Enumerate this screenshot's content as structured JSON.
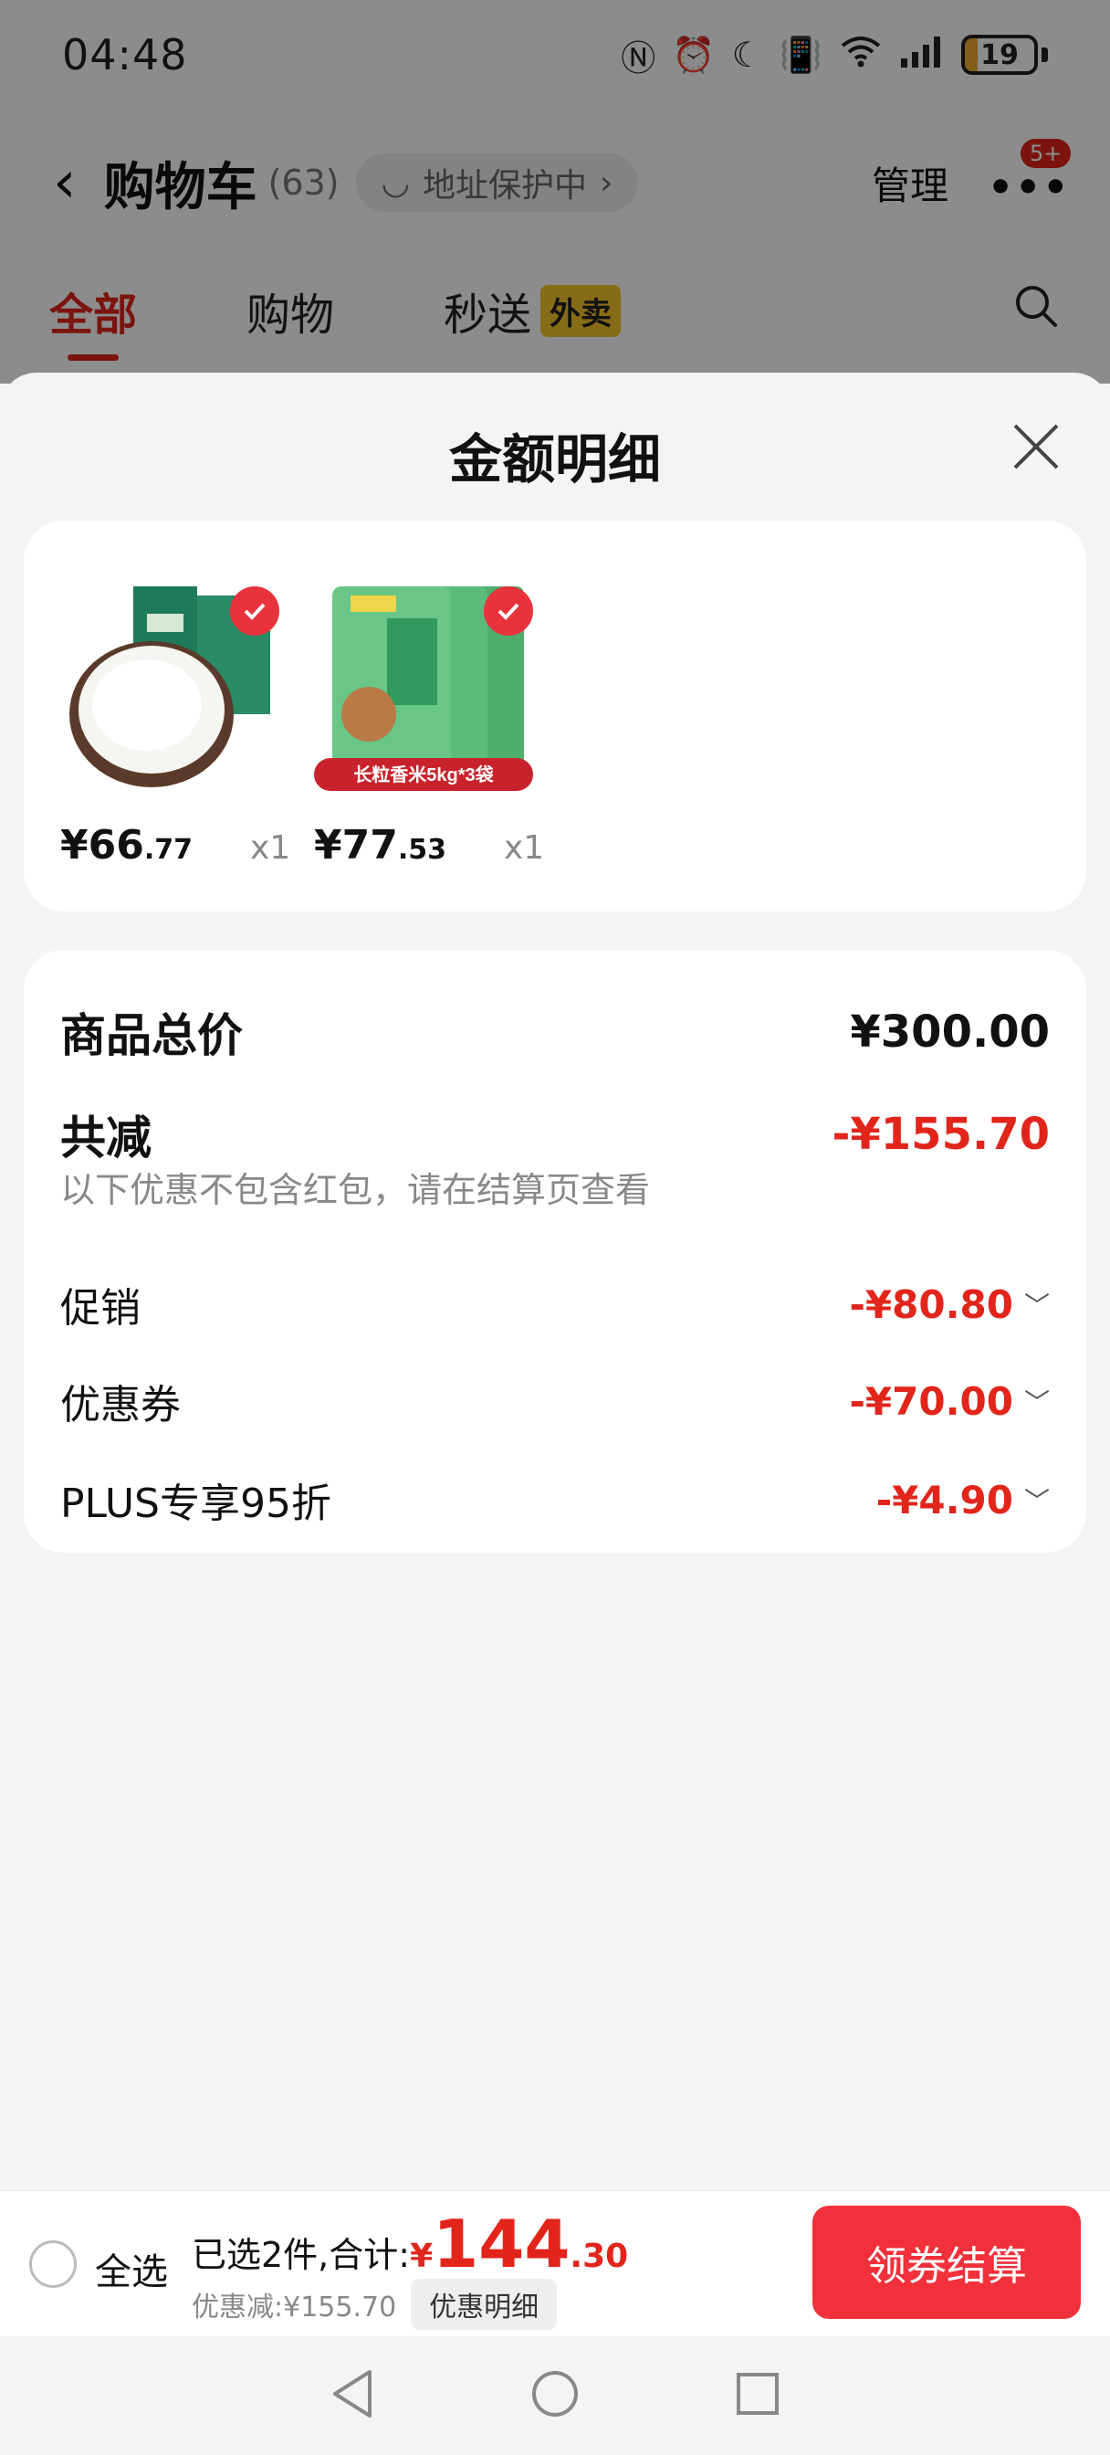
{
  "status_bar": {
    "time": "04:48",
    "battery": "19"
  },
  "header": {
    "title": "购物车",
    "count": "(63)",
    "address_label": "地址保护中",
    "manage_label": "管理",
    "more_badge": "5+"
  },
  "tabs": [
    {
      "label": "全部"
    },
    {
      "label": "购物"
    },
    {
      "label": "秒送",
      "badge": "外卖"
    }
  ],
  "sheet": {
    "title": "金额明细",
    "products": [
      {
        "price_int": "¥66",
        "price_dec": ".77",
        "qty": "x1"
      },
      {
        "price_int": "¥77",
        "price_dec": ".53",
        "qty": "x1",
        "image_banner": "长粒香米5kg*3袋"
      }
    ],
    "summary": {
      "total_label": "商品总价",
      "total_value": "¥300.00",
      "reduce_label": "共减",
      "reduce_value": "-¥155.70",
      "note": "以下优惠不包含红包，请在结算页查看",
      "items": [
        {
          "label": "促销",
          "value": "-¥80.80"
        },
        {
          "label": "优惠券",
          "value": "-¥70.00"
        },
        {
          "label": "PLUS专享95折",
          "value": "-¥4.90"
        }
      ]
    }
  },
  "bottom_bar": {
    "select_all": "全选",
    "summary_prefix": "已选2件,合计:",
    "total_yen": "¥",
    "total_int": "144",
    "total_dec": ".30",
    "discount_text": "优惠减:¥155.70",
    "discount_button": "优惠明细",
    "checkout_button": "领券结算"
  },
  "colors": {
    "accent": "#e1251b",
    "checkout": "#f0303a",
    "tab_badge": "#f6c52b"
  }
}
